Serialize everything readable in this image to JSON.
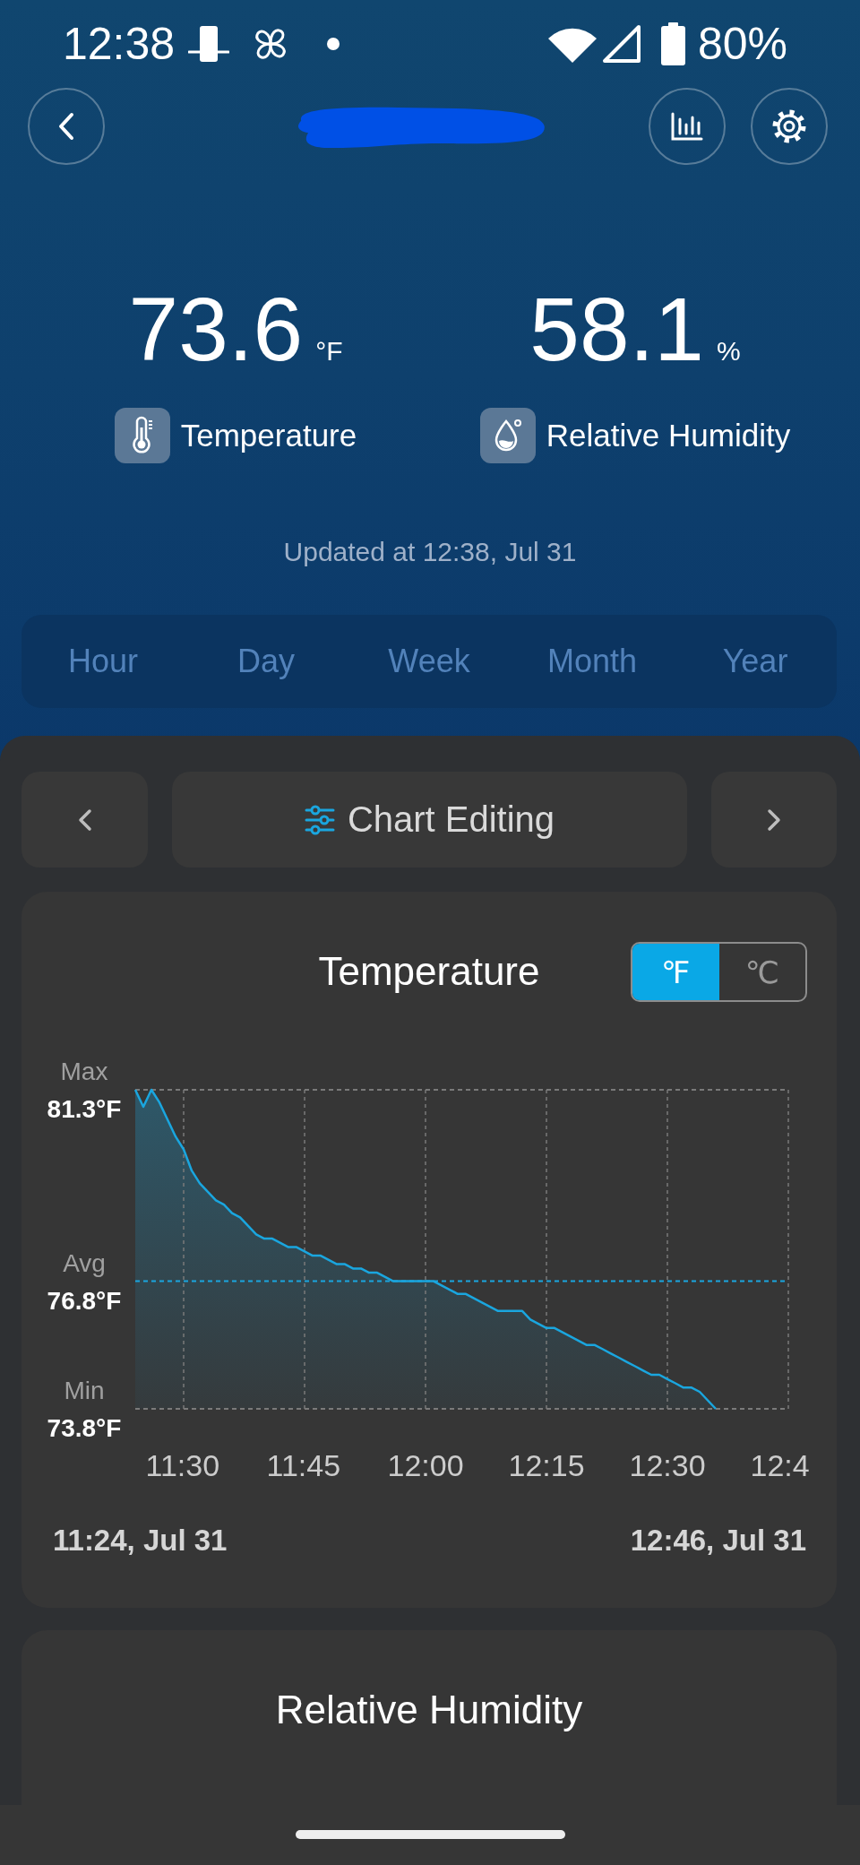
{
  "status_bar": {
    "time": "12:38",
    "battery": "80%"
  },
  "header": {
    "title_redacted": true
  },
  "readings": [
    {
      "kind": "temperature",
      "value": "73.6",
      "unit": "°F",
      "label": "Temperature"
    },
    {
      "kind": "humidity",
      "value": "58.1",
      "unit": "%",
      "label": "Relative Humidity"
    }
  ],
  "updated": "Updated at 12:38, Jul 31",
  "period_tabs": [
    {
      "label": "Hour",
      "selected": false
    },
    {
      "label": "Day",
      "selected": false
    },
    {
      "label": "Week",
      "selected": false
    },
    {
      "label": "Month",
      "selected": false
    },
    {
      "label": "Year",
      "selected": false
    }
  ],
  "chart_nav": {
    "label": "Chart Editing"
  },
  "chart_cards": [
    {
      "title": "Temperature",
      "units": [
        {
          "label": "℉",
          "selected": true
        },
        {
          "label": "℃",
          "selected": false
        }
      ],
      "chart_data": {
        "type": "area",
        "x": [
          684,
          685,
          686,
          687,
          688,
          689,
          690,
          691,
          692,
          693,
          694,
          695,
          696,
          697,
          698,
          699,
          700,
          701,
          702,
          703,
          704,
          705,
          706,
          707,
          708,
          709,
          710,
          711,
          712,
          713,
          714,
          715,
          716,
          717,
          718,
          719,
          720,
          721,
          722,
          723,
          724,
          725,
          726,
          727,
          728,
          729,
          730,
          731,
          732,
          733,
          734,
          735,
          736,
          737,
          738,
          739,
          740,
          741,
          742,
          743,
          744,
          745,
          746,
          747,
          748,
          749,
          750,
          751,
          752,
          753,
          754,
          755,
          756
        ],
        "series": [
          {
            "color": "#1aa6df",
            "values": [
              81.3,
              80.9,
              81.3,
              81.0,
              80.6,
              80.2,
              79.9,
              79.4,
              79.1,
              78.9,
              78.7,
              78.6,
              78.4,
              78.3,
              78.1,
              77.9,
              77.8,
              77.8,
              77.7,
              77.6,
              77.6,
              77.5,
              77.4,
              77.4,
              77.3,
              77.2,
              77.2,
              77.1,
              77.1,
              77.0,
              77.0,
              76.9,
              76.8,
              76.8,
              76.8,
              76.8,
              76.8,
              76.8,
              76.7,
              76.6,
              76.5,
              76.5,
              76.4,
              76.3,
              76.2,
              76.1,
              76.1,
              76.1,
              76.1,
              75.9,
              75.8,
              75.7,
              75.7,
              75.6,
              75.5,
              75.4,
              75.3,
              75.3,
              75.2,
              75.1,
              75.0,
              74.9,
              74.8,
              74.7,
              74.6,
              74.6,
              74.5,
              74.4,
              74.3,
              74.3,
              74.2,
              74.0,
              73.8
            ]
          }
        ],
        "xlim": [
          684,
          765
        ],
        "ylim": [
          73.8,
          81.3
        ],
        "xticks": [
          {
            "value": 690,
            "label": "11:30"
          },
          {
            "value": 705,
            "label": "11:45"
          },
          {
            "value": 720,
            "label": "12:00"
          },
          {
            "value": 735,
            "label": "12:15"
          },
          {
            "value": 750,
            "label": "12:30"
          },
          {
            "value": 765,
            "label": "12:4"
          }
        ],
        "yticks": [
          {
            "value": 73.8,
            "label": "73.8°F"
          },
          {
            "value": 76.8,
            "label": "76.8°F"
          },
          {
            "value": 81.3,
            "label": "81.3°F"
          }
        ],
        "grid": true,
        "ref_lines": [
          {
            "axis": "y",
            "value": 81.3,
            "label": "Max",
            "color": "#7a7a7a"
          },
          {
            "axis": "y",
            "value": 76.8,
            "label": "Avg",
            "color": "#1aa6df"
          },
          {
            "axis": "y",
            "value": 73.8,
            "label": "Min",
            "color": "#7a7a7a"
          }
        ]
      },
      "range_start": "11:24, Jul 31",
      "range_end": "12:46, Jul 31"
    },
    {
      "title": "Relative Humidity"
    }
  ]
}
